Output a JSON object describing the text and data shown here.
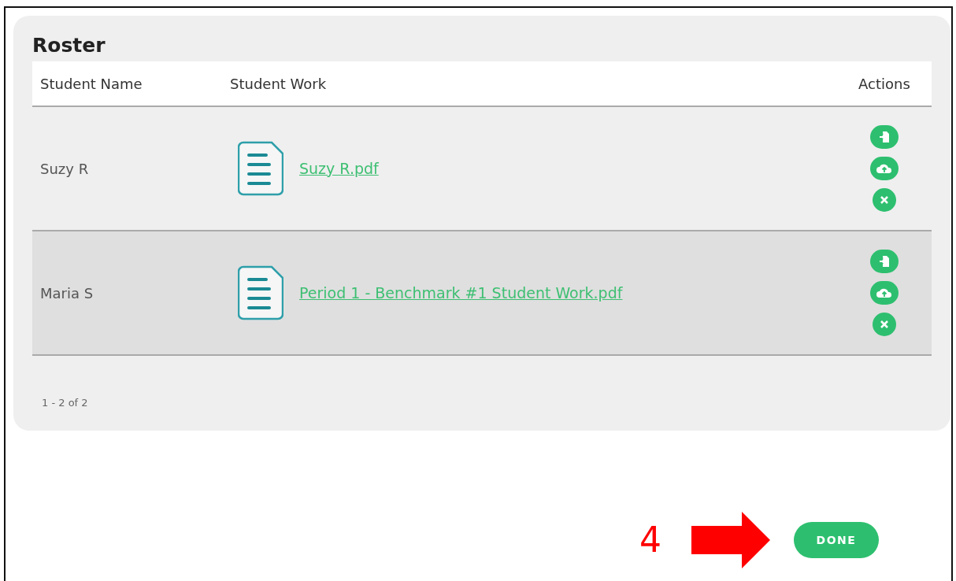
{
  "roster": {
    "title": "Roster",
    "columns": [
      "Student Name",
      "Student Work",
      "Actions"
    ],
    "rows": [
      {
        "name": "Suzy R",
        "file": "Suzy R.pdf",
        "highlighted": false,
        "actions": [
          {
            "kind": "import"
          },
          {
            "kind": "upload"
          },
          {
            "kind": "remove"
          }
        ]
      },
      {
        "name": "Maria S",
        "file": "Period 1 - Benchmark #1 Student Work.pdf",
        "highlighted": true,
        "actions": [
          {
            "kind": "import"
          },
          {
            "kind": "upload"
          },
          {
            "kind": "remove"
          }
        ]
      }
    ],
    "pagination": "1 - 2 of 2"
  },
  "annotation": {
    "step": "4"
  },
  "done_button": "DONE"
}
